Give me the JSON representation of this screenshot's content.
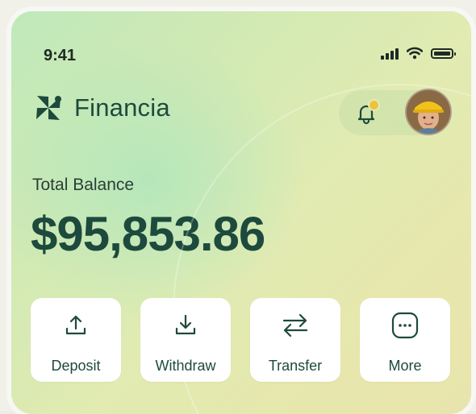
{
  "status_bar": {
    "time": "9:41"
  },
  "brand": {
    "name": "Financia"
  },
  "notifications": {
    "has_unread": true
  },
  "balance": {
    "label": "Total Balance",
    "amount": "$95,853.86"
  },
  "actions": [
    {
      "label": "Deposit",
      "icon": "upload-icon"
    },
    {
      "label": "Withdraw",
      "icon": "download-icon"
    },
    {
      "label": "Transfer",
      "icon": "transfer-arrows-icon"
    },
    {
      "label": "More",
      "icon": "more-dots-icon"
    }
  ],
  "colors": {
    "primary": "#1d4a3c",
    "notification_dot": "#f0c23b",
    "card_bg_start": "#bfe9bb",
    "card_bg_end": "#e8e4ad"
  }
}
